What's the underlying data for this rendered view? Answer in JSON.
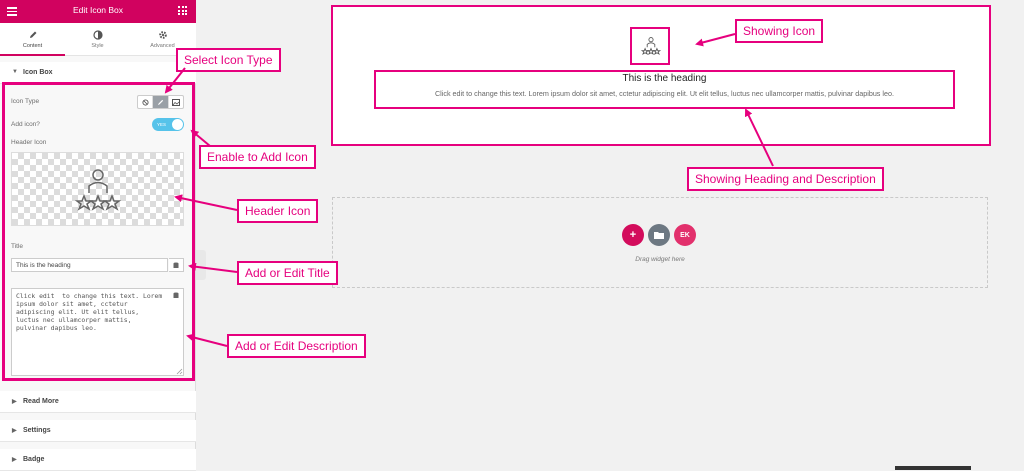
{
  "panel": {
    "title": "Edit Icon Box",
    "tabs": [
      {
        "label": "Content",
        "icon": "pencil-icon",
        "active": true
      },
      {
        "label": "Style",
        "icon": "contrast-icon",
        "active": false
      },
      {
        "label": "Advanced",
        "icon": "gear-icon",
        "active": false
      }
    ],
    "section_icon_box": "Icon Box",
    "icon_type_label": "Icon Type",
    "add_icon_label": "Add icon?",
    "toggle_text": "YES",
    "header_icon_label": "Header Icon",
    "title_label": "Title",
    "title_value": "This is the heading",
    "description_value": "Click edit  to change this text. Lorem ipsum dolor sit amet, cctetur adipiscing elit. Ut elit tellus, luctus nec ullamcorper mattis, pulvinar dapibus leo.",
    "sections_collapsed": [
      "Read More",
      "Settings",
      "Badge"
    ]
  },
  "canvas": {
    "heading": "This is the heading",
    "description": "Click edit to change this text. Lorem ipsum dolor sit amet, cctetur adipiscing elit. Ut elit tellus, luctus nec ullamcorper mattis, pulvinar dapibus leo.",
    "drag_text": "Drag widget here",
    "buttons": [
      {
        "name": "add-section-button",
        "glyph": "+",
        "color": "#d30c5c"
      },
      {
        "name": "template-library-button",
        "glyph": "folder",
        "color": "#6d7882"
      },
      {
        "name": "elementskit-button",
        "glyph": "EK",
        "color": "#e2306c"
      }
    ]
  },
  "annotations": {
    "select_icon_type": "Select Icon Type",
    "enable_add_icon": "Enable to Add Icon",
    "header_icon": "Header Icon",
    "add_edit_title": "Add or Edit Title",
    "add_edit_description": "Add or Edit Description",
    "showing_icon": "Showing Icon",
    "showing_heading_desc": "Showing Heading and Description"
  },
  "colors": {
    "brand": "#d1025f",
    "annotation": "#e6007e",
    "toggle_on": "#56c3ea"
  }
}
